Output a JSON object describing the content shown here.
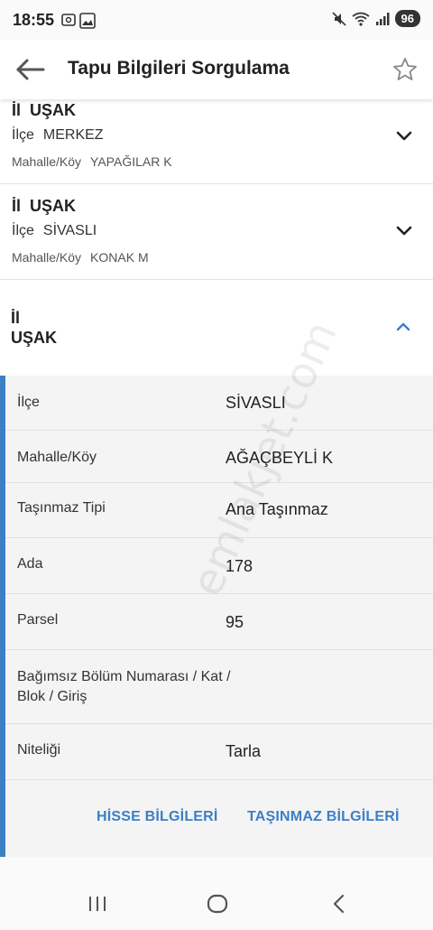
{
  "status_bar": {
    "time": "18:55",
    "battery": "96"
  },
  "app_bar": {
    "title": "Tapu Bilgileri Sorgulama"
  },
  "records": [
    {
      "il_label": "İl",
      "il_value": "UŞAK",
      "ilce_label": "İlçe",
      "ilce_value": "MERKEZ",
      "mahalle_label": "Mahalle/Köy",
      "mahalle_value": "YAPAĞILAR K"
    },
    {
      "il_label": "İl",
      "il_value": "UŞAK",
      "ilce_label": "İlçe",
      "ilce_value": "SİVASLI",
      "mahalle_label": "Mahalle/Köy",
      "mahalle_value": "KONAK M"
    }
  ],
  "expanded": {
    "il_label": "İl",
    "il_value": "UŞAK",
    "rows": [
      {
        "label": "İlçe",
        "value": "SİVASLI"
      },
      {
        "label": "Mahalle/Köy",
        "value": "AĞAÇBEYLİ K"
      },
      {
        "label": "Taşınmaz Tipi",
        "value": "Ana Taşınmaz"
      },
      {
        "label": "Ada",
        "value": "178"
      },
      {
        "label": "Parsel",
        "value": "95"
      },
      {
        "label": "Bağımsız Bölüm Numarası / Kat / Blok / Giriş",
        "value": ""
      },
      {
        "label": "Niteliği",
        "value": "Tarla"
      }
    ],
    "hisse_button": "HİSSE BİLGİLERİ",
    "tasinmaz_button": "TAŞINMAZ BİLGİLERİ"
  },
  "watermark": "emlakjet.com",
  "colors": {
    "accent": "#3c7fc4",
    "panel": "#f4f4f4"
  }
}
